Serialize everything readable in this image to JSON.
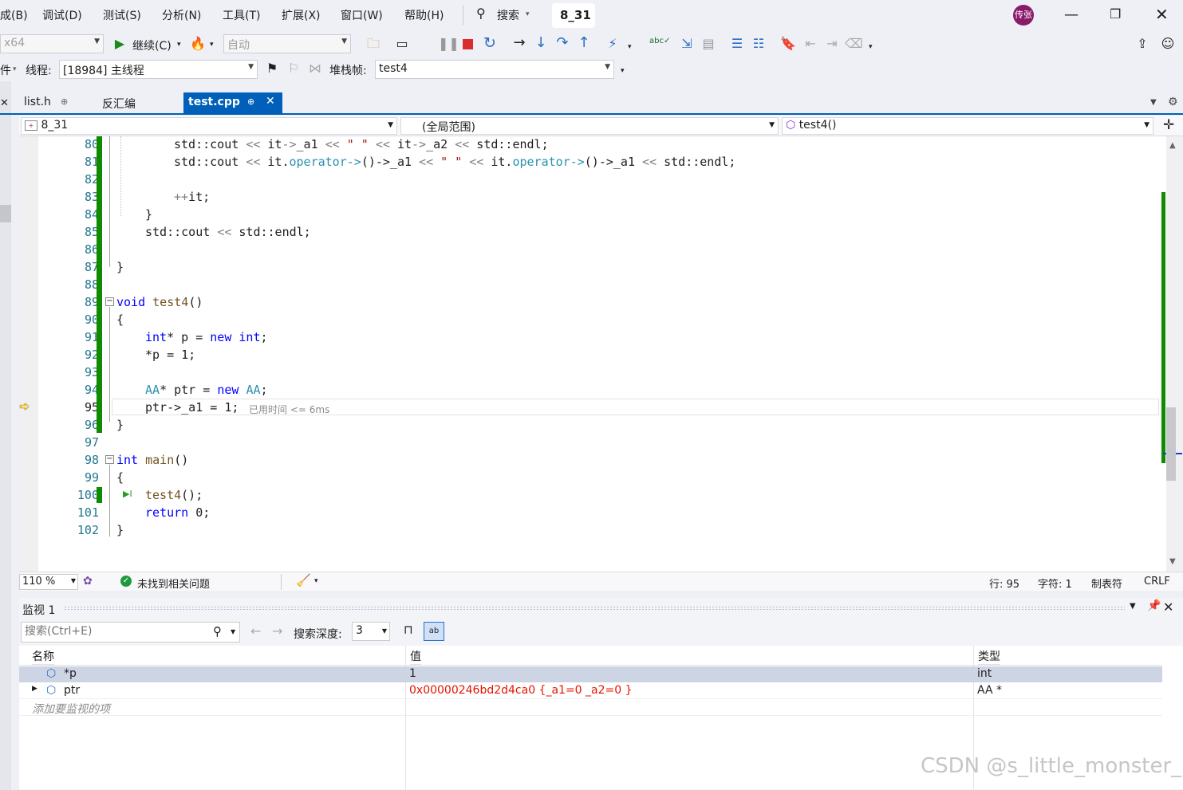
{
  "menu": {
    "items": [
      "成(B)",
      "调试(D)",
      "测试(S)",
      "分析(N)",
      "工具(T)",
      "扩展(X)",
      "窗口(W)",
      "帮助(H)"
    ],
    "search_label": "搜索",
    "solution_name": "8_31",
    "user_badge": "传张"
  },
  "toolbar": {
    "platform": "x64",
    "continue_label": "继续(C)",
    "auto_label": "自动"
  },
  "debugbar": {
    "thread_prefix": "件",
    "thread_label": "线程:",
    "thread_value": "[18984] 主线程",
    "stack_label": "堆栈帧:",
    "stack_value": "test4"
  },
  "tabs": [
    {
      "label": "list.h",
      "pin": "⊕"
    },
    {
      "label": "反汇编",
      "pin": ""
    },
    {
      "label": "test.cpp",
      "pin": "⊕"
    }
  ],
  "nav": {
    "project": "8_31",
    "scope": "(全局范围)",
    "member": "test4()"
  },
  "code": {
    "line_numbers": [
      "80",
      "81",
      "82",
      "83",
      "84",
      "85",
      "86",
      "87",
      "88",
      "89",
      "90",
      "91",
      "92",
      "93",
      "94",
      "95",
      "96",
      "97",
      "98",
      "99",
      "100",
      "101",
      "102"
    ],
    "current_line": "95",
    "elapsed_hint": "已用时间 <= 6ms"
  },
  "status": {
    "zoom": "110 %",
    "issues": "未找到相关问题",
    "line": "行: 95",
    "char": "字符: 1",
    "tab": "制表符",
    "eol": "CRLF"
  },
  "watch": {
    "title": "监视 1",
    "search_placeholder": "搜索(Ctrl+E)",
    "depth_label": "搜索深度:",
    "depth_value": "3",
    "columns": [
      "名称",
      "值",
      "类型"
    ],
    "rows": [
      {
        "name": "*p",
        "value": "1",
        "type": "int"
      },
      {
        "name": "ptr",
        "value": "0x00000246bd2d4ca0 {_a1=0 _a2=0 }",
        "type": "AA *"
      }
    ],
    "add_hint": "添加要监视的项"
  },
  "watermark": "CSDN @s_little_monster_",
  "colors": {
    "accent": "#005fb8",
    "changed_value": "#e51400",
    "change_bar": "#108a00",
    "menu_bg": "#eef0f5"
  }
}
